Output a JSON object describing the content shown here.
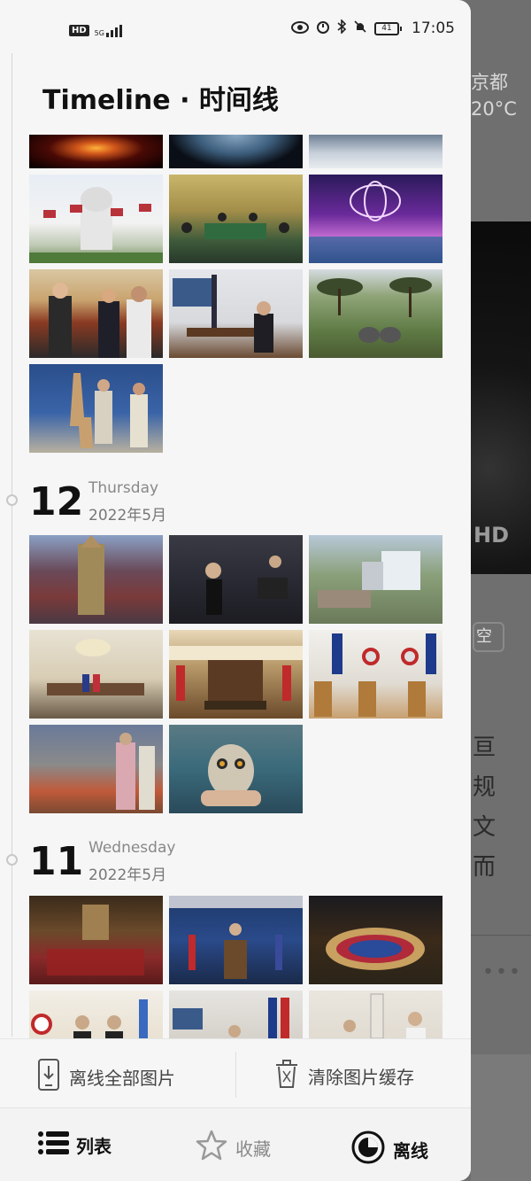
{
  "status_bar": {
    "time": "17:05",
    "network": "5G",
    "hd": "HD",
    "battery": "41"
  },
  "header": {
    "title": "Timeline · 时间线"
  },
  "groups": [
    {
      "day": "12",
      "weekday": "Thursday",
      "month": "2022年5月"
    },
    {
      "day": "11",
      "weekday": "Wednesday",
      "month": "2022年5月"
    }
  ],
  "actions": {
    "offline_all": "离线全部图片",
    "clear_cache": "清除图片缓存"
  },
  "tabs": [
    {
      "label": "列表",
      "icon": "list-icon",
      "active": true
    },
    {
      "label": "收藏",
      "icon": "star-icon",
      "active": false
    },
    {
      "label": "离线",
      "icon": "offline-icon",
      "active": false
    }
  ],
  "background_app": {
    "weather_city": "京都",
    "weather_temp": "20°C",
    "hd_label": "HD",
    "chip": "空",
    "text_lines": [
      "亘",
      "规",
      "文",
      "而"
    ]
  },
  "colors": {
    "drawer_bg": "#f6f6f6",
    "overlay": "#6f6f6f",
    "text": "#111111",
    "muted": "#888888"
  }
}
